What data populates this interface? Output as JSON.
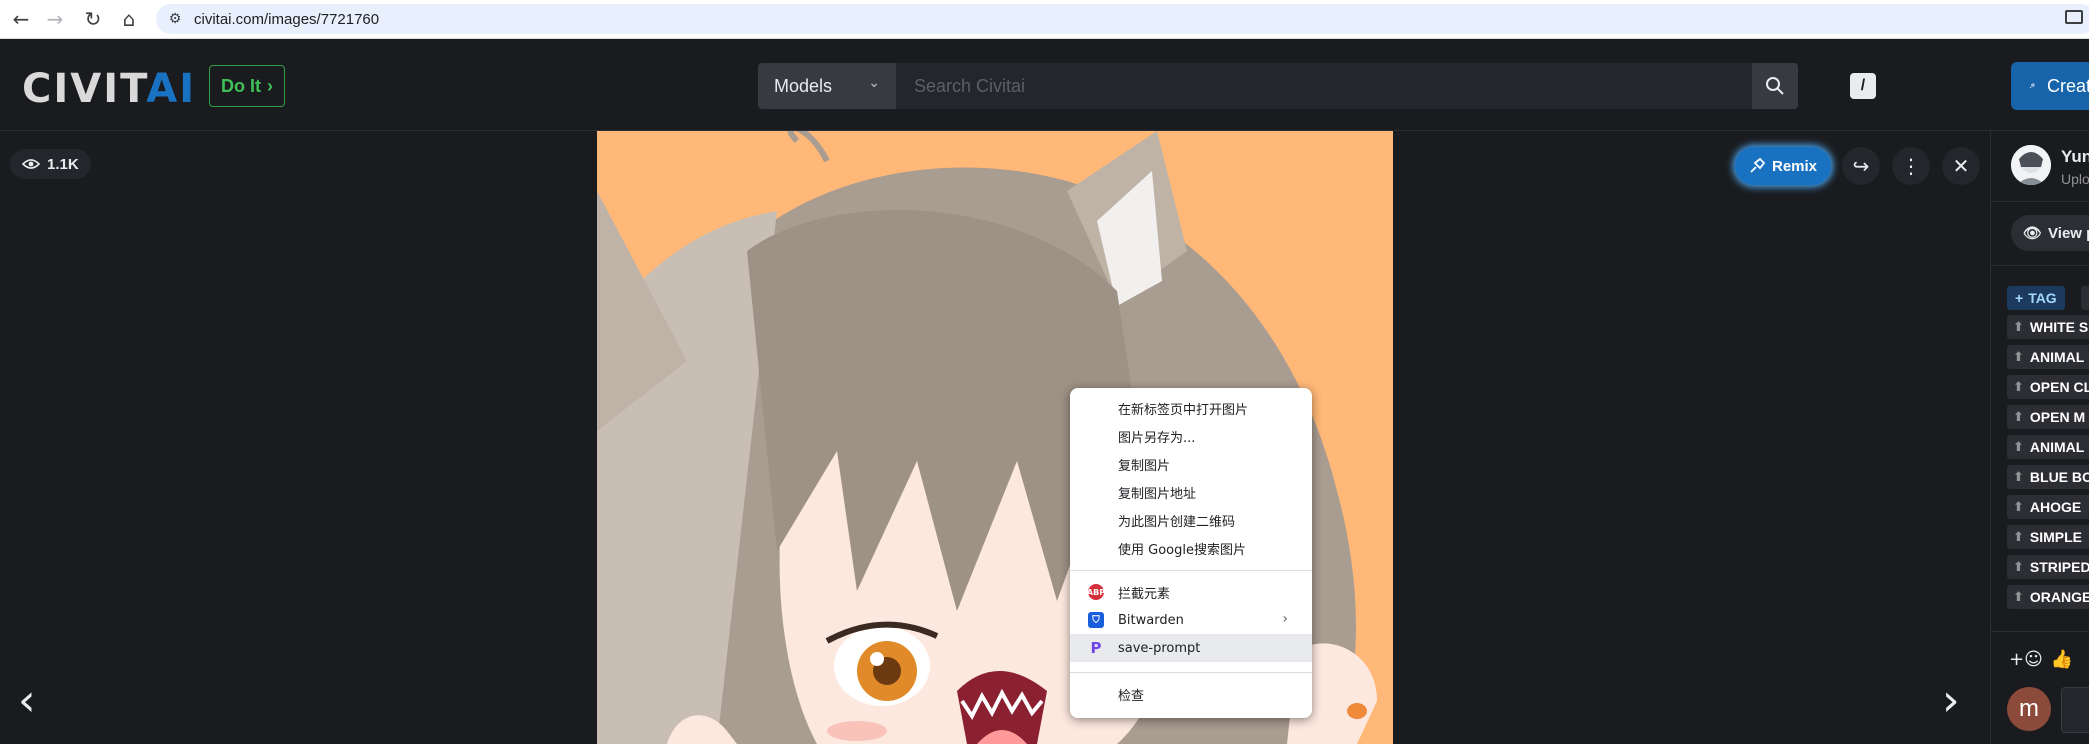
{
  "browser": {
    "back_icon": "arrow-left-icon",
    "forward_icon": "arrow-right-icon",
    "reload_icon": "reload-icon",
    "home_icon": "home-icon",
    "url": "civitai.com/images/7721760"
  },
  "header": {
    "logo_left": "CIVIT",
    "logo_right": "AI",
    "doit_label": "Do It",
    "search_category": "Models",
    "search_placeholder": "Search Civitai",
    "slash_key": "/",
    "create_label": "Create",
    "colors": {
      "accent": "#1971c2",
      "doit": "#40c057"
    }
  },
  "viewer": {
    "view_count": "1.1K",
    "remix_label": "Remix",
    "image_description_icon": "anime-illustration"
  },
  "sidebar": {
    "user_name": "Yun",
    "user_sub": "Uplo",
    "view_post_label": "View p",
    "tag_add_label": "TAG",
    "tags": [
      "WHITE S",
      "ANIMAL",
      "OPEN CL",
      "OPEN M",
      "ANIMAL",
      "BLUE BO",
      "AHOGE",
      "SIMPLE",
      "STRIPED",
      "ORANGE"
    ],
    "comment_avatar_letter": "m"
  },
  "context_menu": {
    "items": [
      "在新标签页中打开图片",
      "图片另存为...",
      "复制图片",
      "复制图片地址",
      "为此图片创建二维码",
      "使用 Google搜索图片"
    ],
    "extensions": [
      {
        "label": "拦截元素",
        "icon": "abp-icon"
      },
      {
        "label": "Bitwarden",
        "icon": "bitwarden-icon"
      },
      {
        "label": "save-prompt",
        "icon": "save-prompt-icon"
      }
    ],
    "inspect": "检查"
  }
}
